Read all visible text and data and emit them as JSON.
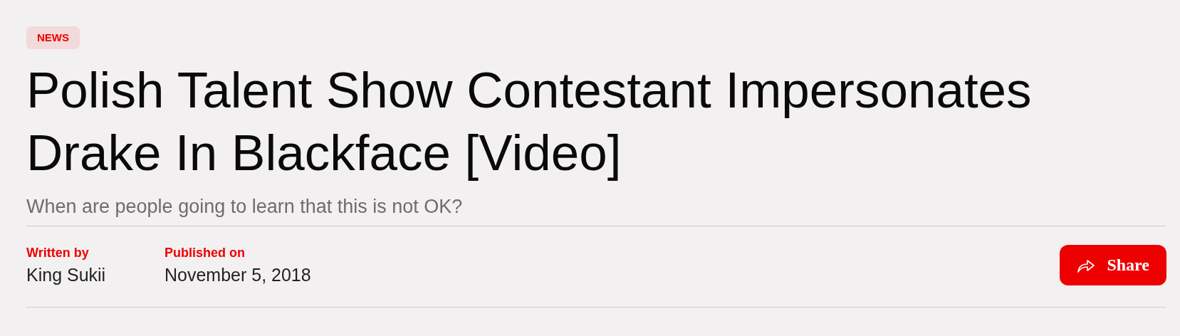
{
  "category": "NEWS",
  "headline": "Polish Talent Show Contestant Impersonates Drake In Blackface [Video]",
  "subheadline": "When are people going to learn that this is not OK?",
  "meta": [
    {
      "label": "Written by",
      "value": "King Sukii"
    },
    {
      "label": "Published on",
      "value": "November 5, 2018"
    }
  ],
  "share_button": "Share"
}
